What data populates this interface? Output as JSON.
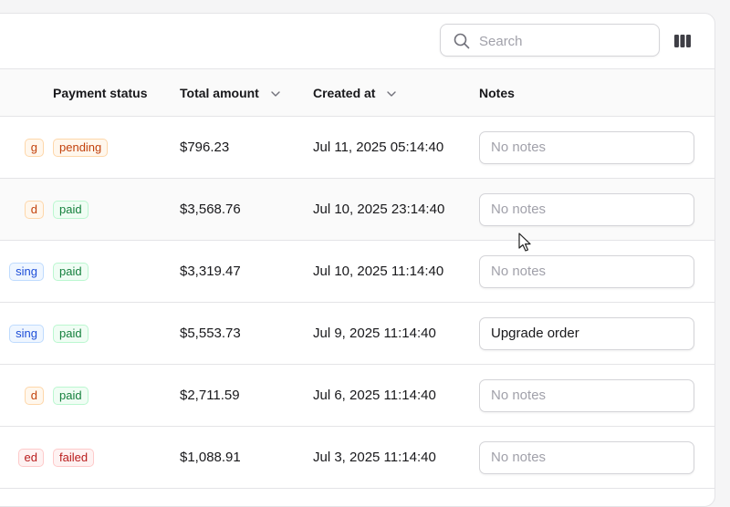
{
  "search": {
    "placeholder": "Search",
    "value": ""
  },
  "toolbar": {
    "columns_icon": "columns-icon"
  },
  "columns": {
    "payment_status": "Payment status",
    "total_amount": "Total amount",
    "created_at": "Created at",
    "notes": "Notes"
  },
  "rows": [
    {
      "fulfillment": "g",
      "fulfillment_kind": "pending",
      "payment": "pending",
      "total": "$796.23",
      "created": "Jul 11, 2025 05:14:40",
      "notes_value": "",
      "notes_placeholder": "No notes"
    },
    {
      "fulfillment": "d",
      "fulfillment_kind": "pending",
      "payment": "paid",
      "total": "$3,568.76",
      "created": "Jul 10, 2025 23:14:40",
      "notes_value": "",
      "notes_placeholder": "No notes"
    },
    {
      "fulfillment": "sing",
      "fulfillment_kind": "processing",
      "payment": "paid",
      "total": "$3,319.47",
      "created": "Jul 10, 2025 11:14:40",
      "notes_value": "",
      "notes_placeholder": "No notes"
    },
    {
      "fulfillment": "sing",
      "fulfillment_kind": "processing",
      "payment": "paid",
      "total": "$5,553.73",
      "created": "Jul 9, 2025 11:14:40",
      "notes_value": "Upgrade order",
      "notes_placeholder": "No notes"
    },
    {
      "fulfillment": "d",
      "fulfillment_kind": "pending",
      "payment": "paid",
      "total": "$2,711.59",
      "created": "Jul 6, 2025 11:14:40",
      "notes_value": "",
      "notes_placeholder": "No notes"
    },
    {
      "fulfillment": "ed",
      "fulfillment_kind": "failed",
      "payment": "failed",
      "total": "$1,088.91",
      "created": "Jul 3, 2025 11:14:40",
      "notes_value": "",
      "notes_placeholder": "No notes"
    }
  ],
  "colors": {
    "pending": "#c2410c",
    "paid": "#15803d",
    "processing": "#1d4ed8",
    "failed": "#b91c1c"
  }
}
